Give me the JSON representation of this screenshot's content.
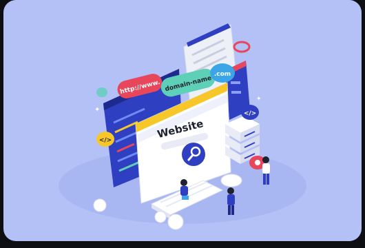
{
  "illustration": {
    "url_pill_1": "http://www.",
    "url_pill_2": "domain-name",
    "url_pill_3": ".com",
    "website_title": "Website",
    "code_badge_left": "</>",
    "code_badge_right": "</>"
  },
  "colors": {
    "background": "#b3c1f7",
    "frame": "#0d0f12",
    "primary_blue": "#2f3fc2",
    "accent_red": "#e8465b",
    "accent_teal": "#5fd0b8",
    "accent_yellow": "#f7c629",
    "accent_cyan": "#3aa6e8"
  }
}
